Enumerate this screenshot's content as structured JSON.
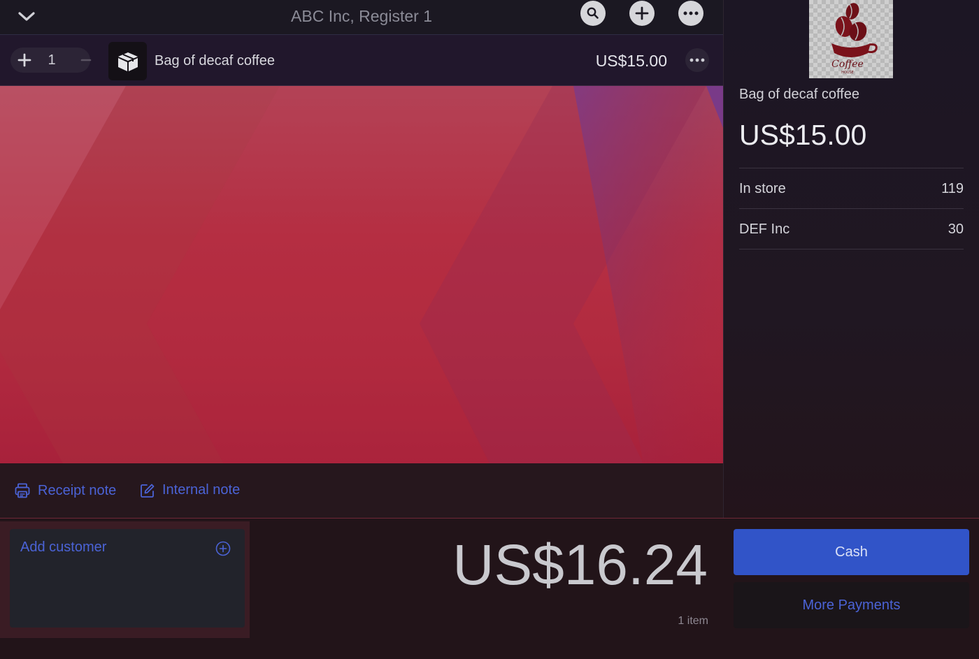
{
  "header": {
    "title": "ABC Inc, Register 1",
    "collapse_icon": "chevron-down-icon",
    "search_icon": "search-icon",
    "add_icon": "plus-icon",
    "more_icon": "more-icon"
  },
  "line_item": {
    "quantity": "1",
    "name": "Bag of decaf coffee",
    "price": "US$15.00",
    "thumb_icon": "box-icon"
  },
  "notes": {
    "receipt_label": "Receipt note",
    "internal_label": "Internal note"
  },
  "product_panel": {
    "image_text": "Coffee",
    "image_subtext": "HOUSE",
    "name": "Bag of decaf coffee",
    "price": "US$15.00",
    "stock": [
      {
        "location": "In store",
        "count": "119"
      },
      {
        "location": "DEF Inc",
        "count": "30"
      }
    ]
  },
  "customer": {
    "label": "Add customer"
  },
  "summary": {
    "total": "US$16.24",
    "item_count": "1 item"
  },
  "payments": {
    "cash_label": "Cash",
    "more_label": "More Payments"
  },
  "colors": {
    "accent": "#3154c8",
    "link": "#4b63d6"
  }
}
